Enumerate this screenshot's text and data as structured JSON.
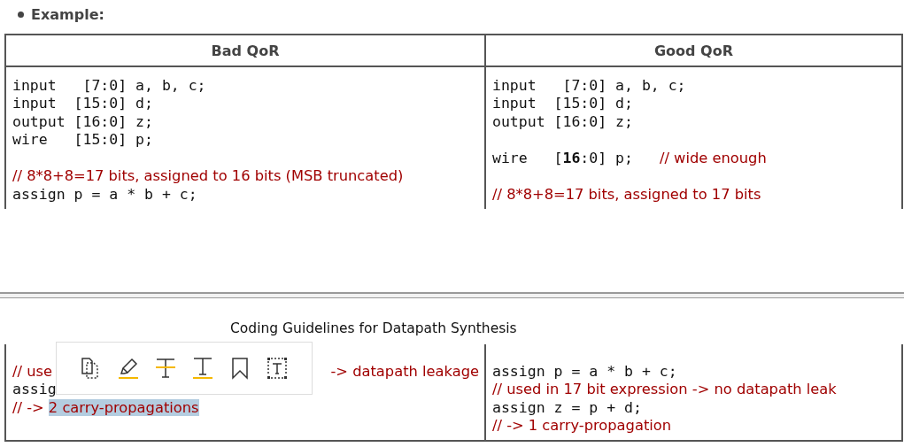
{
  "bullet": {
    "label": "Example:"
  },
  "top_table": {
    "columns": [
      "Bad QoR",
      "Good QoR"
    ],
    "cells": [
      [
        {
          "kind": "code",
          "text": "input   [7:0] a, b, c;"
        },
        {
          "kind": "code",
          "text": "input  [15:0] d;"
        },
        {
          "kind": "code",
          "text": "output [16:0] z;"
        },
        {
          "kind": "code",
          "text": "wire   [15:0] p;"
        },
        {
          "kind": "blank"
        },
        {
          "kind": "comment",
          "text": "// 8*8+8=17 bits, assigned to 16 bits (MSB truncated)"
        },
        {
          "kind": "code",
          "text": "assign p = a * b + c;"
        }
      ],
      [
        {
          "kind": "code",
          "text": "input   [7:0] a, b, c;"
        },
        {
          "kind": "code",
          "text": "input  [15:0] d;"
        },
        {
          "kind": "code",
          "text": "output [16:0] z;"
        },
        {
          "kind": "blank"
        },
        {
          "kind": "mixed",
          "text": "wire   [**16**:0] p;",
          "comment": "// wide enough"
        },
        {
          "kind": "blank"
        },
        {
          "kind": "comment",
          "text": "// 8*8+8=17 bits, assigned to 17 bits"
        }
      ]
    ]
  },
  "bottom_page": {
    "title": "Coding Guidelines for Datapath Synthesis",
    "cells": [
      [
        {
          "kind": "blank"
        },
        {
          "kind": "split",
          "text": "// use",
          "right": "-> datapath leakage"
        },
        {
          "kind": "code",
          "text": "assig"
        },
        {
          "kind": "comment",
          "text": "// -> ",
          "highlight": "2 carry-propagations"
        },
        {
          "kind": "blank"
        }
      ],
      [
        {
          "kind": "blank"
        },
        {
          "kind": "code",
          "text": "assign p = a * b + c;"
        },
        {
          "kind": "comment",
          "text": "// used in 17 bit expression -> no datapath leak"
        },
        {
          "kind": "code",
          "text": "assign z = p + d;"
        },
        {
          "kind": "comment",
          "text": "// -> 1 carry-propagation"
        }
      ]
    ]
  },
  "popup_toolbar": {
    "tools": [
      {
        "kind": "copy"
      },
      {
        "kind": "highlight"
      },
      {
        "kind": "strike"
      },
      {
        "kind": "underline"
      },
      {
        "kind": "bookmark"
      },
      {
        "kind": "textbox"
      }
    ]
  }
}
